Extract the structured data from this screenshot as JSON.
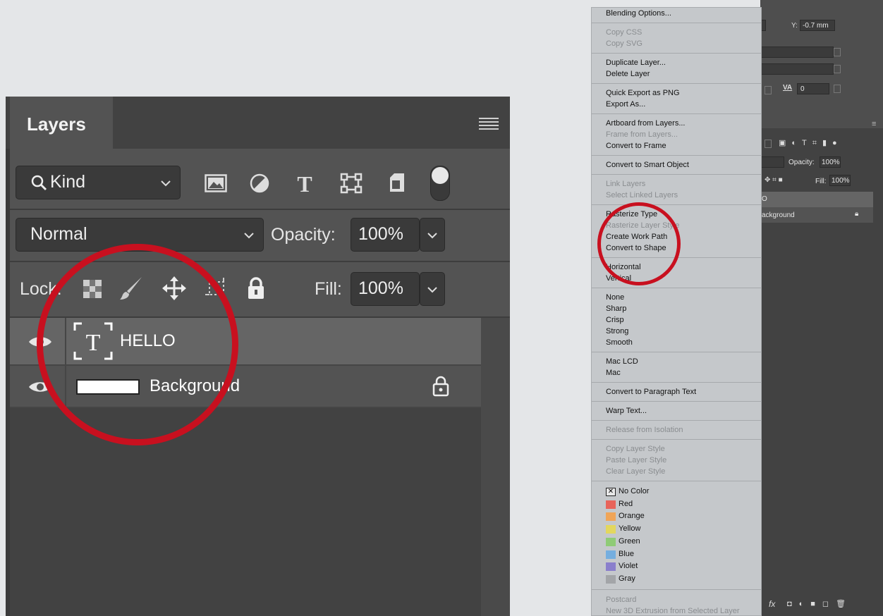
{
  "layers_panel": {
    "title": "Layers",
    "filter_kind": "Kind",
    "blend_mode": "Normal",
    "opacity_label": "Opacity:",
    "opacity_value": "100%",
    "lock_label": "Lock:",
    "fill_label": "Fill:",
    "fill_value": "100%",
    "layers": [
      {
        "name": "HELLO",
        "type": "text",
        "selected": true,
        "visible": true
      },
      {
        "name": "Background",
        "type": "pixel",
        "locked": true,
        "visible": true
      }
    ]
  },
  "right_panel": {
    "y_label": "Y:",
    "y_value": "-0.7 mm",
    "tracking_value": "0",
    "opacity_label": "Opacity:",
    "opacity_value": "100%",
    "fill_label": "Fill:",
    "fill_value": "100%",
    "layer_partial_1": "O",
    "layer_partial_2": "ackground",
    "footer_fx": "fx"
  },
  "context_menu": {
    "groups": [
      [
        {
          "label": "Blending Options...",
          "enabled": true
        }
      ],
      [
        {
          "label": "Copy CSS",
          "enabled": false
        },
        {
          "label": "Copy SVG",
          "enabled": false
        }
      ],
      [
        {
          "label": "Duplicate Layer...",
          "enabled": true
        },
        {
          "label": "Delete Layer",
          "enabled": true
        }
      ],
      [
        {
          "label": "Quick Export as PNG",
          "enabled": true
        },
        {
          "label": "Export As...",
          "enabled": true
        }
      ],
      [
        {
          "label": "Artboard from Layers...",
          "enabled": true
        },
        {
          "label": "Frame from Layers...",
          "enabled": false
        },
        {
          "label": "Convert to Frame",
          "enabled": true
        }
      ],
      [
        {
          "label": "Convert to Smart Object",
          "enabled": true
        }
      ],
      [
        {
          "label": "Link Layers",
          "enabled": false
        },
        {
          "label": "Select Linked Layers",
          "enabled": false
        }
      ],
      [
        {
          "label": "Rasterize Type",
          "enabled": true
        },
        {
          "label": "Rasterize Layer Style",
          "enabled": false
        },
        {
          "label": "Create Work Path",
          "enabled": true
        },
        {
          "label": "Convert to Shape",
          "enabled": true
        }
      ],
      [
        {
          "label": "Horizontal",
          "enabled": true
        },
        {
          "label": "Vertical",
          "enabled": true
        }
      ],
      [
        {
          "label": "None",
          "enabled": true
        },
        {
          "label": "Sharp",
          "enabled": true
        },
        {
          "label": "Crisp",
          "enabled": true
        },
        {
          "label": "Strong",
          "enabled": true
        },
        {
          "label": "Smooth",
          "enabled": true
        }
      ],
      [
        {
          "label": "Mac LCD",
          "enabled": true
        },
        {
          "label": "Mac",
          "enabled": true
        }
      ],
      [
        {
          "label": "Convert to Paragraph Text",
          "enabled": true
        }
      ],
      [
        {
          "label": "Warp Text...",
          "enabled": true
        }
      ],
      [
        {
          "label": "Release from Isolation",
          "enabled": false
        }
      ],
      [
        {
          "label": "Copy Layer Style",
          "enabled": false
        },
        {
          "label": "Paste Layer Style",
          "enabled": false
        },
        {
          "label": "Clear Layer Style",
          "enabled": false
        }
      ]
    ],
    "colors": [
      {
        "label": "No Color",
        "swatch": "none"
      },
      {
        "label": "Red",
        "swatch": "#e8645a"
      },
      {
        "label": "Orange",
        "swatch": "#f0a558"
      },
      {
        "label": "Yellow",
        "swatch": "#e3d75e"
      },
      {
        "label": "Green",
        "swatch": "#8fcb76"
      },
      {
        "label": "Blue",
        "swatch": "#75aedf"
      },
      {
        "label": "Violet",
        "swatch": "#8a7fcc"
      },
      {
        "label": "Gray",
        "swatch": "#a3a5a8"
      }
    ],
    "footer": [
      {
        "label": "Postcard",
        "enabled": false
      },
      {
        "label": "New 3D Extrusion from Selected Layer",
        "enabled": false
      }
    ]
  },
  "annotation_color": "#c8101f"
}
